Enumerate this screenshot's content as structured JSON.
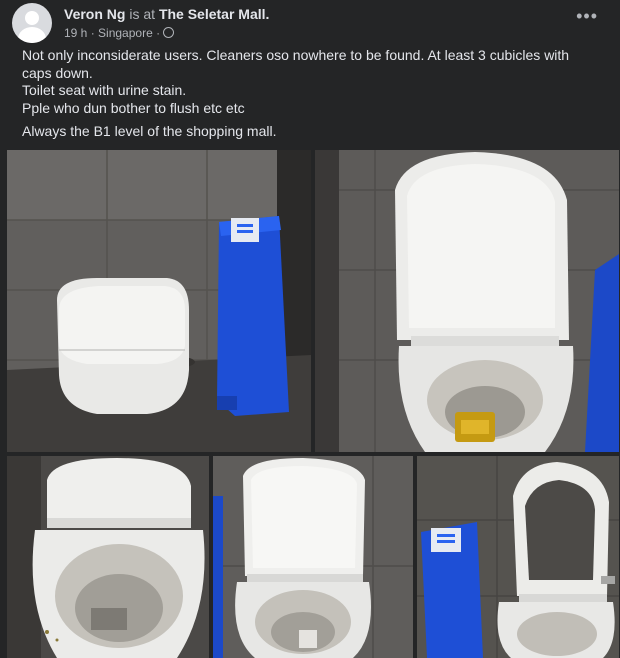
{
  "post": {
    "author": "Veron Ng",
    "is_at": "is at",
    "location": "The Seletar Mall.",
    "time": "19 h",
    "place": "Singapore",
    "more_icon": "more-horizontal-icon",
    "privacy_icon": "globe-icon",
    "text": {
      "line1": "Not only inconsiderate users. Cleaners oso nowhere to be found. At least 3 cubicles with caps down.",
      "line2": "Toilet seat with urine stain.",
      "line3": "Pple who dun bother to flush etc etc",
      "line4": "Always the B1 level of the shopping mall."
    }
  },
  "colors": {
    "background": "#242526",
    "text": "#e4e6eb",
    "secondary": "#b0b3b8",
    "bin_blue": "#1e4fd6"
  }
}
